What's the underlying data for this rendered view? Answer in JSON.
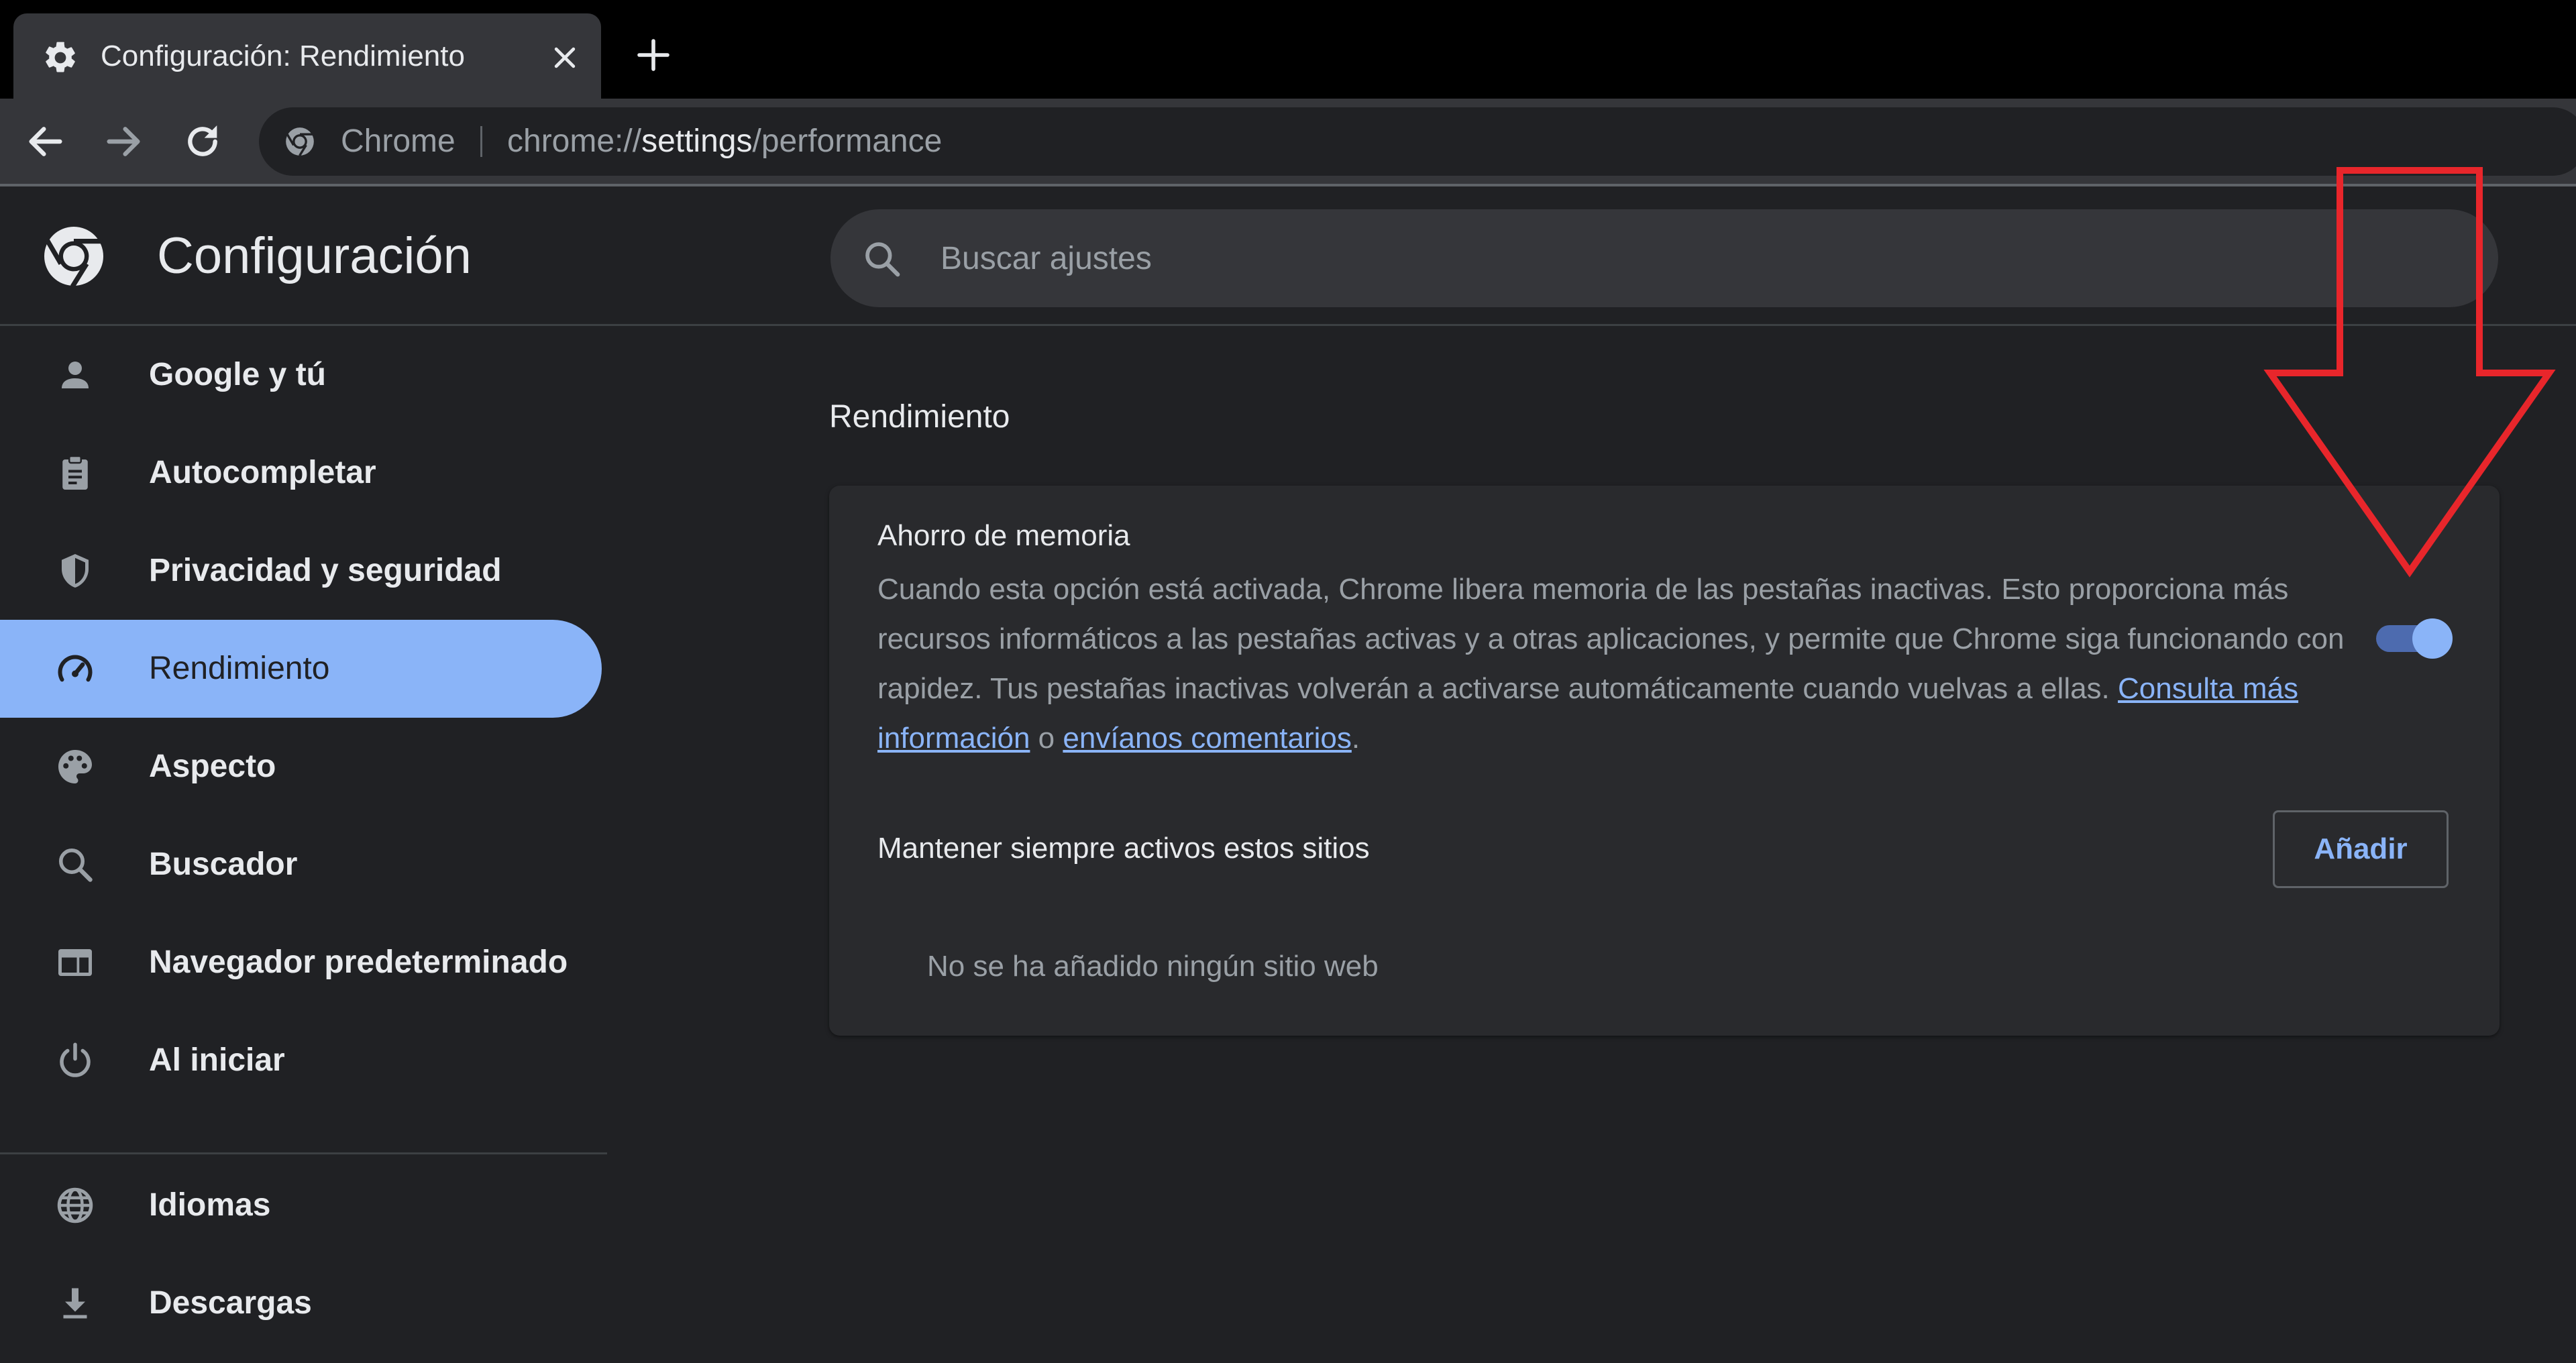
{
  "tab": {
    "title": "Configuración: Rendimiento",
    "icon": "gear-icon"
  },
  "toolbar": {
    "chip_label": "Chrome",
    "url_scheme": "chrome://",
    "url_host": "settings",
    "url_path": "/performance"
  },
  "header": {
    "title": "Configuración",
    "search_placeholder": "Buscar ajustes"
  },
  "sidebar": {
    "items": [
      {
        "label": "Google y tú",
        "icon": "person-icon"
      },
      {
        "label": "Autocompletar",
        "icon": "clipboard-icon"
      },
      {
        "label": "Privacidad y seguridad",
        "icon": "shield-icon"
      },
      {
        "label": "Rendimiento",
        "icon": "speedometer-icon",
        "active": true
      },
      {
        "label": "Aspecto",
        "icon": "palette-icon"
      },
      {
        "label": "Buscador",
        "icon": "search-icon"
      },
      {
        "label": "Navegador predeterminado",
        "icon": "browser-window-icon"
      },
      {
        "label": "Al iniciar",
        "icon": "power-icon"
      },
      {
        "label": "Idiomas",
        "icon": "globe-icon"
      },
      {
        "label": "Descargas",
        "icon": "download-icon"
      }
    ]
  },
  "main": {
    "section_title": "Rendimiento",
    "memory_saver": {
      "title": "Ahorro de memoria",
      "description": "Cuando esta opción está activada, Chrome libera memoria de las pestañas inactivas. Esto proporciona más recursos informáticos a las pestañas activas y a otras aplicaciones, y permite que Chrome siga funcionando con rapidez. Tus pestañas inactivas volverán a activarse automáticamente cuando vuelvas a ellas.",
      "link_more": "Consulta más información",
      "connector": "o",
      "link_feedback": "envíanos comentarios",
      "enabled": true
    },
    "always_active": {
      "label": "Mantener siempre activos estos sitios",
      "add_button": "Añadir",
      "empty_text": "No se ha añadido ningún sitio web"
    }
  },
  "colors": {
    "accent": "#8ab4f8",
    "annotation": "#e8262b",
    "background": "#202124"
  }
}
